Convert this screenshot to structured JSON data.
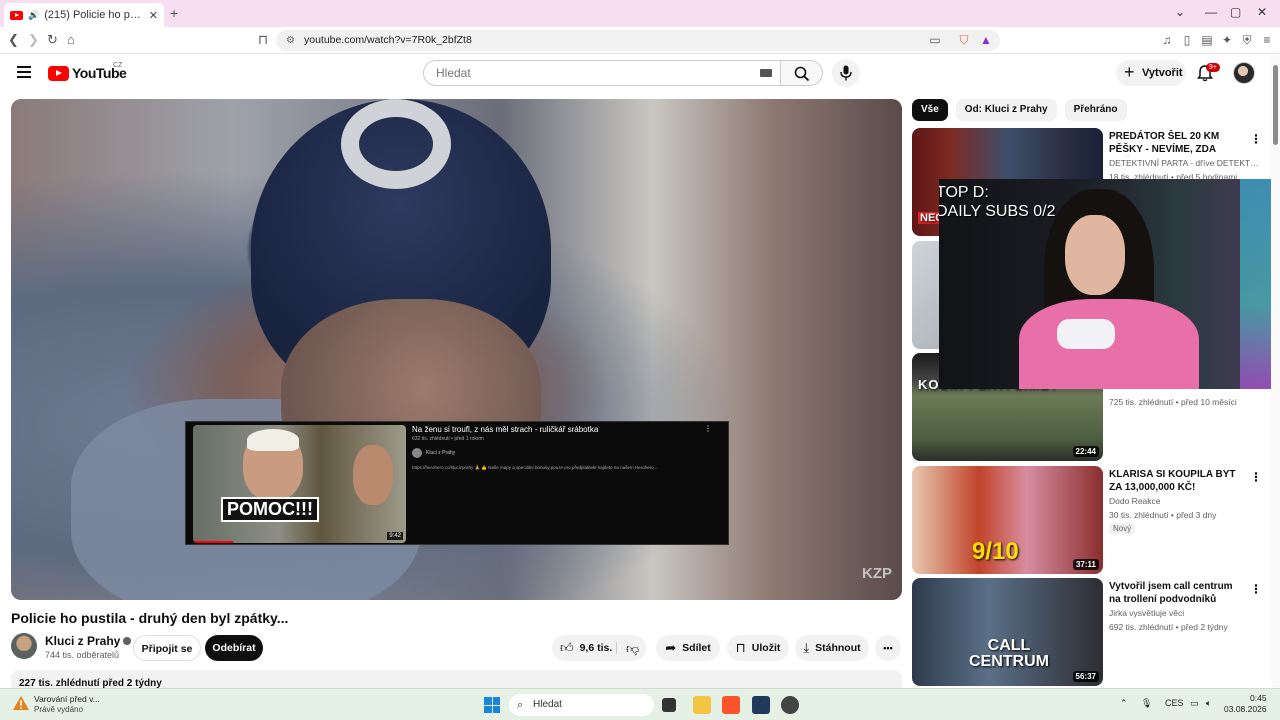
{
  "browser": {
    "tab_title": "(215) Policie ho pustila - druhý den byl zpátky...",
    "new_tab": "+",
    "url": "youtube.com/watch?v=7R0k_2bfZt8"
  },
  "youtube": {
    "logo_text": "YouTube",
    "logo_country": "CZ",
    "search_placeholder": "Hledat",
    "create_label": "Vytvořit",
    "notification_count": "9+"
  },
  "player": {
    "watermark": "KZP",
    "endcard": {
      "thumb_text": "POMOC!!!",
      "duration": "9:42",
      "title": "Na ženu si troufl, z nás měl strach - ruličkář srábotka",
      "meta": "632 tis. zhlédnutí • před 1 rokem",
      "channel": "Kluci z Prahy",
      "description": "https://herohero.co/klucizprahy 🙏 👍 Naše mapy a speciální bonusy pouze pro předplatitele najdete na našem Herohero..."
    }
  },
  "video": {
    "title": "Policie ho pustila - druhý den byl zpátky...",
    "channel_name": "Kluci z Prahy",
    "subscribers": "744 tis. odběratelů",
    "join_label": "Připojit se",
    "subscribe_label": "Odebírat",
    "likes": "9,6 tis.",
    "share_label": "Sdílet",
    "save_label": "Uložit",
    "download_label": "Stáhnout",
    "more_label": "•••",
    "description_meta": "227 tis. zhlédnutí  před 2 týdny"
  },
  "sidebar": {
    "chips": [
      "Vše",
      "Od: Kluci z Prahy",
      "Přehráno"
    ],
    "cards": [
      {
        "title": "PREDÁTOR ŠEL 20 KM PĚŠKY - NEVÍME, ZDA DOŠEL...",
        "channel": "DETEKTIVNÍ PARTA - dříve DETEKTIV MI...",
        "meta": "18 tis. zhlédnutí • před 5 hodinami",
        "duration": "",
        "thumb_text": "NEC"
      },
      {
        "title": "",
        "channel": "",
        "meta": "",
        "duration": "",
        "thumb_text": ""
      },
      {
        "title": "",
        "channel": "",
        "meta": "725 tis. zhlédnutí • před 10 měsíci",
        "duration": "22:44",
        "thumb_text": "KOLIK PLATÍ LIME?"
      },
      {
        "title": "KLARISA SI KOUPILA BYT ZA 13,000,000 KČ!",
        "channel": "Dodo Reakce",
        "meta": "30 tis. zhlédnutí • před 3 dny",
        "badge": "Nový",
        "duration": "37:11",
        "thumb_text": "9/10"
      },
      {
        "title": "Vytvořil jsem call centrum na trollení podvodníků",
        "channel": "Jirka vysvětluje věci",
        "meta": "692 tis. zhlédnutí • před 2 týdny",
        "duration": "56:37",
        "thumb_text": "CALL CENTRUM"
      }
    ]
  },
  "stream_overlay": {
    "title_line1": "TOP D:",
    "title_line2": "DAILY SUBS 0/2"
  },
  "taskbar": {
    "warning_title": "Varování před v...",
    "warning_sub": "Právě vydáno",
    "search_label": "Hledat",
    "language": "CES",
    "time": "0:45",
    "date": "03.08.2026"
  }
}
